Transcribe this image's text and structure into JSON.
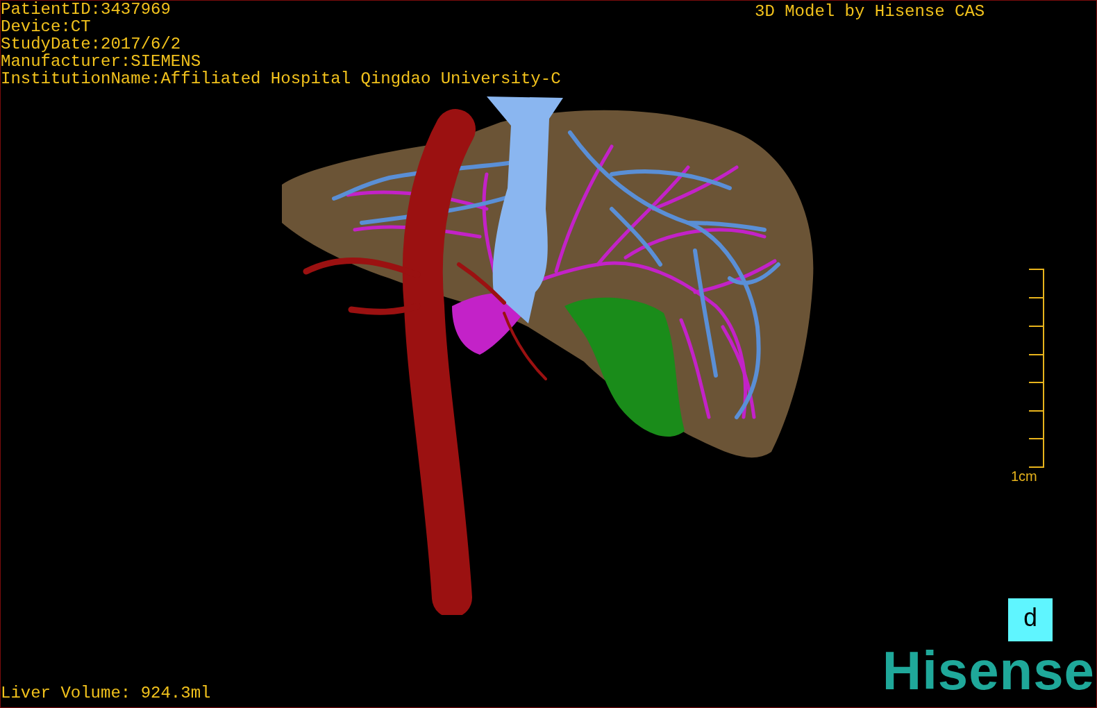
{
  "patient_info": [
    "PatientID:3437969",
    "Device:CT",
    "StudyDate:2017/6/2",
    "Manufacturer:SIEMENS",
    "InstitutionName:Affiliated Hospital Qingdao University-C"
  ],
  "title": "3D Model by Hisense CAS",
  "scale_bar": {
    "label": "1cm"
  },
  "orientation_cube": {
    "label": "d"
  },
  "logo": "Hisense",
  "liver_volume": "Liver Volume: 924.3ml"
}
